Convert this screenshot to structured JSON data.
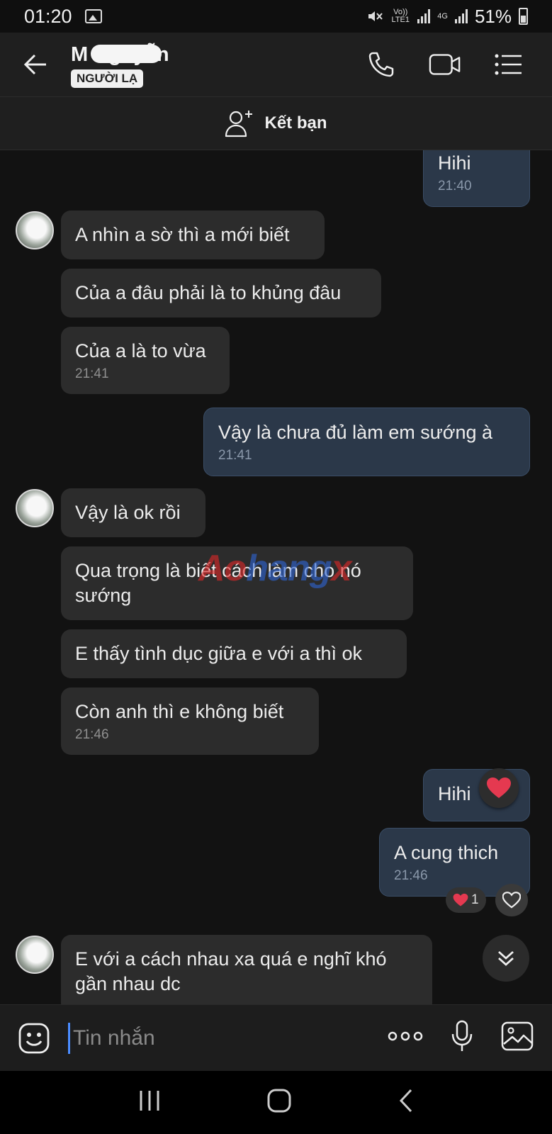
{
  "status_bar": {
    "time": "01:20",
    "sim1_label": "Vo)) LTE1",
    "sim2_label": "4G",
    "battery": "51%"
  },
  "header": {
    "name": "M Nguyễn",
    "badge": "NGƯỜI LẠ"
  },
  "add_friend": {
    "label": "Kết bạn"
  },
  "messages": {
    "m0": {
      "text": "Hihi",
      "time": "21:40"
    },
    "m1": {
      "text": "A nhìn a sờ thì a mới biết"
    },
    "m2": {
      "text": "Của a đâu phải là to khủng đâu"
    },
    "m3": {
      "text": "Của a là to vừa",
      "time": "21:41"
    },
    "m4": {
      "text": "Vậy là chưa đủ làm em sướng à",
      "time": "21:41"
    },
    "m5": {
      "text": "Vậy là ok rồi"
    },
    "m6": {
      "text": "Qua trọng là biết cách làm cho nó sướng"
    },
    "m7": {
      "text": "E thấy tình dục giữa e với a thì ok"
    },
    "m8": {
      "text": "Còn anh thì e không biết",
      "time": "21:46"
    },
    "m9": {
      "text": "Hihi"
    },
    "m10": {
      "text": "A cung thich",
      "time": "21:46",
      "reaction_count": "1"
    },
    "m11": {
      "text": "E với a cách nhau xa quá e nghĩ khó gần nhau dc"
    }
  },
  "watermark": {
    "part_a": "Ao",
    "part_b": "hang",
    "part_c": "x"
  },
  "composer": {
    "placeholder": "Tin nhắn"
  },
  "colors": {
    "background": "#121212",
    "incoming_bubble": "#2c2c2c",
    "outgoing_bubble": "#2b3849",
    "heart": "#e53950",
    "cursor": "#4a8cff"
  },
  "icons": {
    "back": "arrow-left-icon",
    "call": "phone-icon",
    "video": "video-camera-icon",
    "menu": "list-menu-icon",
    "add_friend": "add-person-icon",
    "emoji": "emoji-icon",
    "more": "more-dots-icon",
    "mic": "microphone-icon",
    "image": "image-icon",
    "scroll_down": "double-chevron-down-icon"
  }
}
